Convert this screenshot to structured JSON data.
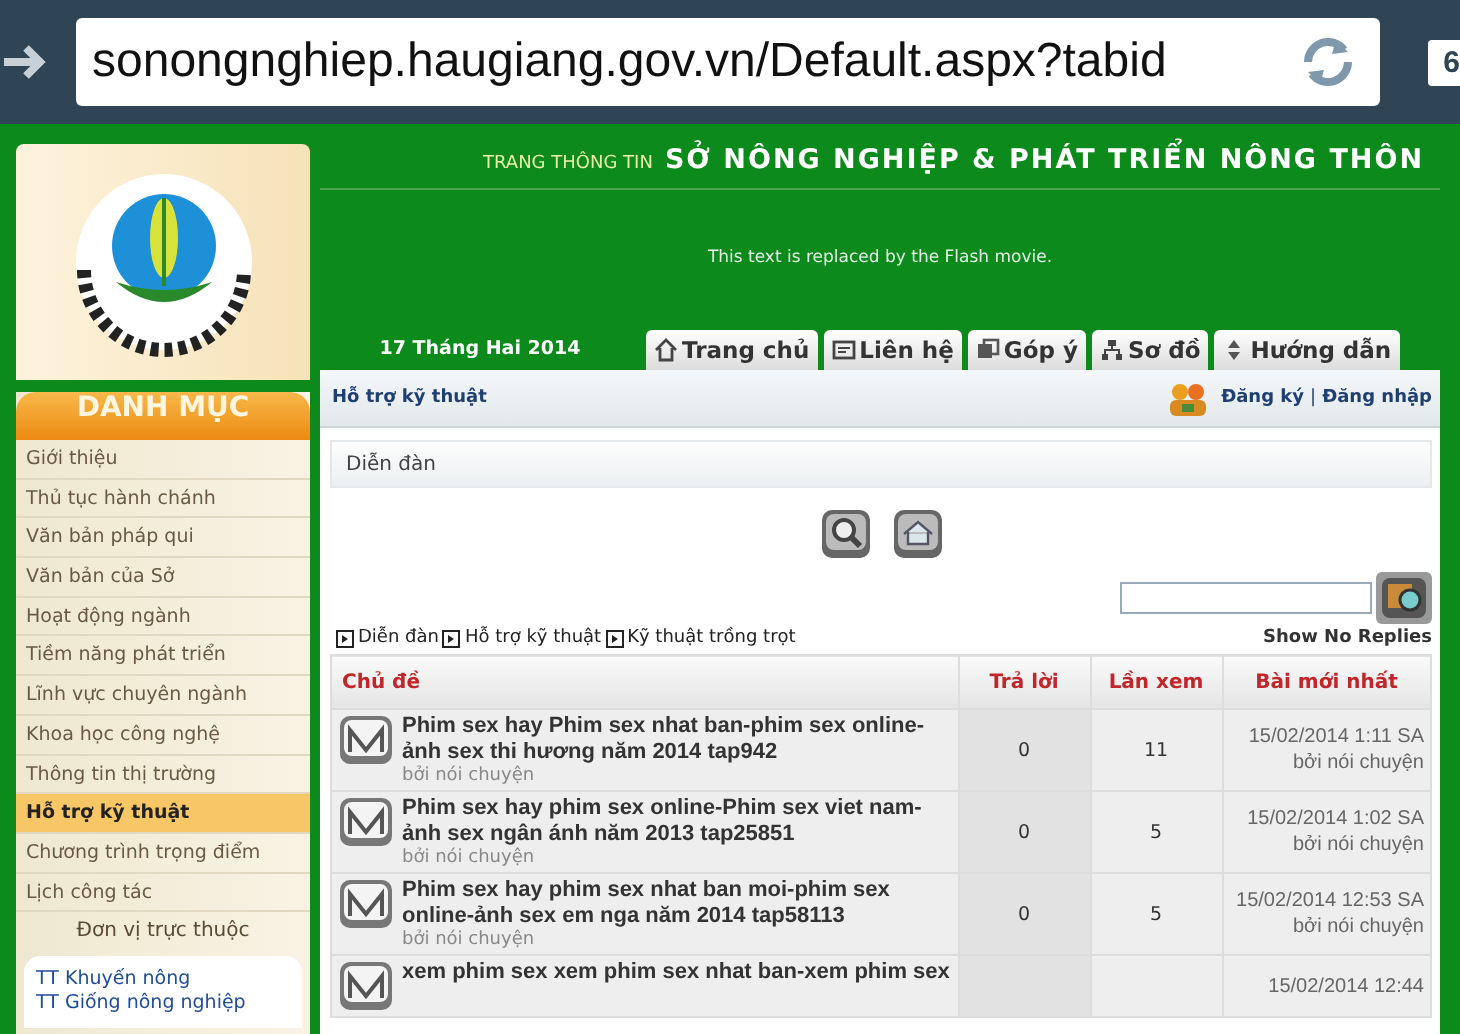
{
  "browser": {
    "url": "sonongnghiep.haugiang.gov.vn/Default.aspx?tabid",
    "tab_count": "6"
  },
  "header": {
    "kicker": "TRANG THÔNG TIN",
    "title": "SỞ NÔNG NGHIỆP & PHÁT TRIỂN NÔNG THÔN",
    "flash_text": "This text is replaced by the Flash movie.",
    "date": "17 Tháng Hai 2014",
    "tabs": [
      {
        "label": "Trang chủ",
        "kind": "home"
      },
      {
        "label": "Liên hệ",
        "kind": "contact"
      },
      {
        "label": "Góp ý",
        "kind": "feedback"
      },
      {
        "label": "Sơ đồ",
        "kind": "sitemap"
      },
      {
        "label": "Hướng dẫn",
        "kind": "guide"
      }
    ]
  },
  "sidebar": {
    "title": "DANH MỤC",
    "items": [
      {
        "label": "Giới thiệu",
        "selected": false
      },
      {
        "label": "Thủ tục hành chánh",
        "selected": false
      },
      {
        "label": "Văn bản pháp qui",
        "selected": false
      },
      {
        "label": "Văn bản của Sở",
        "selected": false
      },
      {
        "label": "Hoạt động ngành",
        "selected": false
      },
      {
        "label": "Tiềm năng phát triển",
        "selected": false
      },
      {
        "label": "Lĩnh vực chuyên ngành",
        "selected": false
      },
      {
        "label": "Khoa học công nghệ",
        "selected": false
      },
      {
        "label": "Thông tin thị trường",
        "selected": false
      },
      {
        "label": "Hỗ trợ kỹ thuật",
        "selected": true
      },
      {
        "label": "Chương trình trọng điểm",
        "selected": false
      },
      {
        "label": "Lịch công tác",
        "selected": false
      }
    ],
    "units_title": "Đơn vị trực thuộc",
    "units": [
      "TT Khuyến nông",
      "TT Giống nông nghiệp"
    ]
  },
  "content": {
    "page_title": "Hỗ trợ kỹ thuật",
    "register": "Đăng ký",
    "separator": "|",
    "login": "Đăng nhập",
    "panel_title": "Diễn đàn",
    "breadcrumb": [
      "Diễn đàn",
      "Hỗ trợ kỹ thuật",
      "Kỹ thuật trồng trọt"
    ],
    "show_no_replies": "Show No Replies",
    "table": {
      "columns": [
        "Chủ đề",
        "Trả lời",
        "Lần xem",
        "Bài mới nhất"
      ],
      "rows": [
        {
          "title": "Phim sex hay Phim sex nhat ban-phim sex online-ảnh sex thi hương năm 2014 tap942",
          "author": "bởi nói chuyện",
          "replies": "0",
          "views": "11",
          "last_date": "15/02/2014 1:11 SA",
          "last_by": "bởi nói chuyện"
        },
        {
          "title": "Phim sex hay phim sex online-Phim sex viet nam-ảnh sex ngân ánh năm 2013 tap25851",
          "author": "bởi nói chuyện",
          "replies": "0",
          "views": "5",
          "last_date": "15/02/2014 1:02 SA",
          "last_by": "bởi nói chuyện"
        },
        {
          "title": "Phim sex hay phim sex nhat ban moi-phim sex online-ảnh sex em nga năm 2014 tap58113",
          "author": "bởi nói chuyện",
          "replies": "0",
          "views": "5",
          "last_date": "15/02/2014 12:53 SA",
          "last_by": "bởi nói chuyện"
        },
        {
          "title": "xem phim sex xem phim sex nhat ban-xem phim sex",
          "last_date": "15/02/2014 12:44"
        }
      ]
    }
  }
}
